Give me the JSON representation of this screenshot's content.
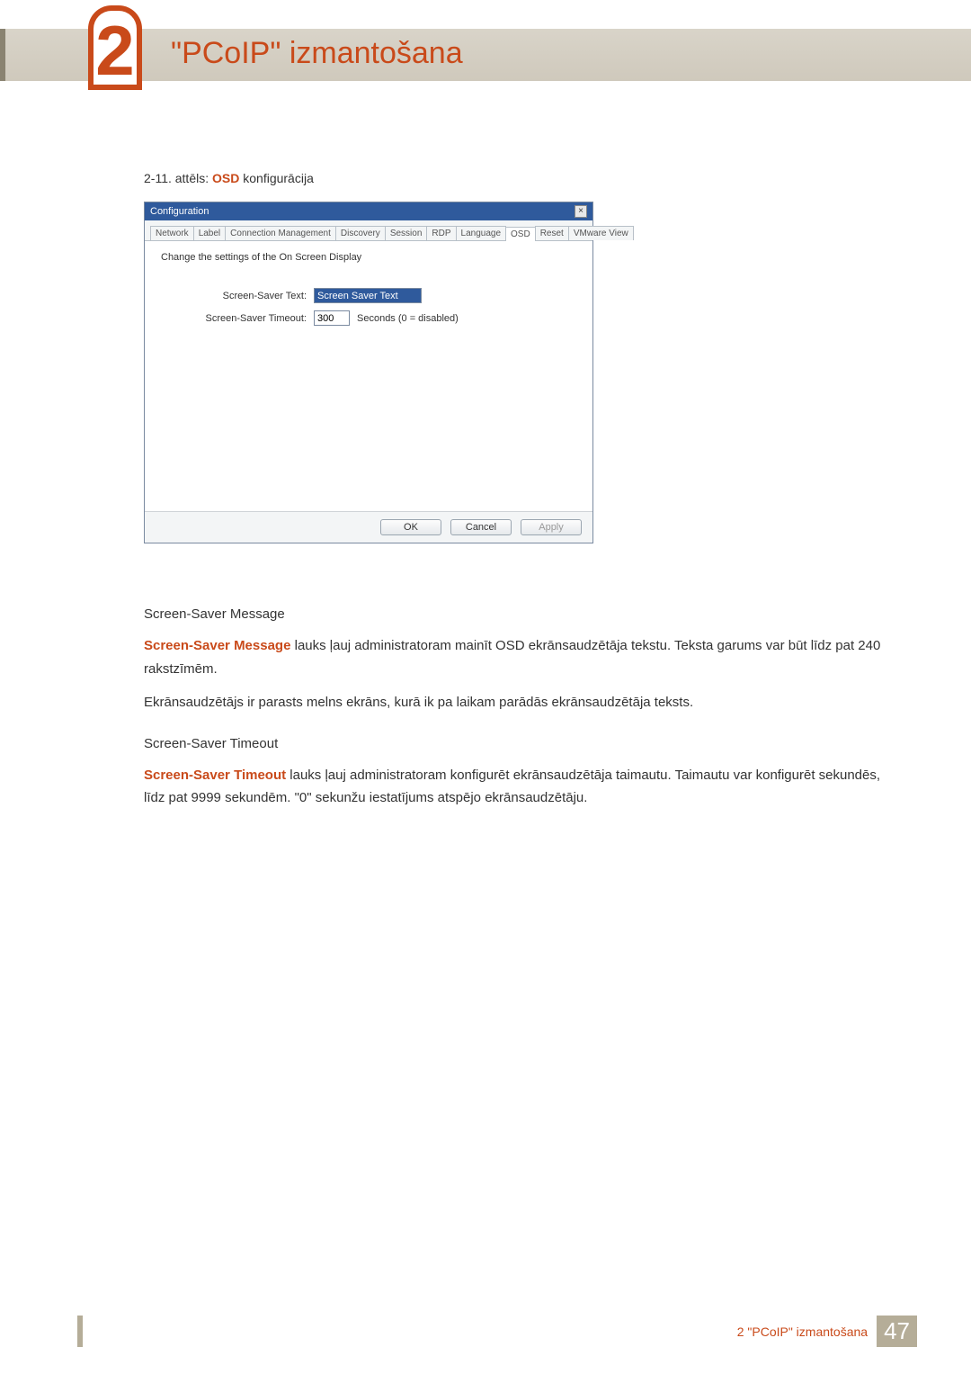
{
  "chapter": {
    "number": "2",
    "title": "\"PCoIP\" izmantošana"
  },
  "figure_caption": {
    "prefix": "2-11. attēls: ",
    "highlight": "OSD",
    "suffix": " konfigurācija"
  },
  "dialog": {
    "title": "Configuration",
    "tabs": [
      "Network",
      "Label",
      "Connection Management",
      "Discovery",
      "Session",
      "RDP",
      "Language",
      "OSD",
      "Reset",
      "VMware View"
    ],
    "active_tab": "OSD",
    "intro": "Change the settings of the On Screen Display",
    "rows": {
      "text_label": "Screen-Saver Text:",
      "text_value": "Screen Saver Text",
      "timeout_label": "Screen-Saver Timeout:",
      "timeout_value": "300",
      "timeout_suffix": "Seconds (0 = disabled)"
    },
    "buttons": {
      "ok": "OK",
      "cancel": "Cancel",
      "apply": "Apply"
    }
  },
  "body": {
    "h1": "Screen-Saver Message",
    "p1a": "Screen-Saver Message",
    "p1b": " lauks ļauj administratoram mainīt OSD ekrānsaudzētāja tekstu. Teksta garums var būt līdz pat 240 rakstzīmēm.",
    "p2": "Ekrānsaudzētājs ir parasts melns ekrāns, kurā ik pa laikam parādās ekrānsaudzētāja teksts.",
    "h2": "Screen-Saver Timeout",
    "p3a": "Screen-Saver Timeout",
    "p3b": " lauks ļauj administratoram konfigurēt ekrānsaudzētāja taimautu. Taimautu var konfigurēt sekundēs, līdz pat 9999 sekundēm. \"0\" sekunžu iestatījums atspējo ekrānsaudzētāju."
  },
  "footer": {
    "text": "2 \"PCoIP\" izmantošana",
    "page": "47"
  }
}
